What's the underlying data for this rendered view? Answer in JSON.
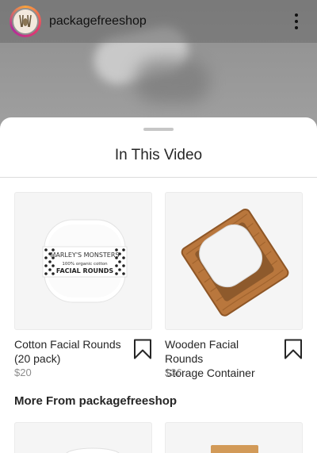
{
  "header": {
    "username": "packagefreeshop",
    "avatar_icon": "packagefreeshop-logo-icon",
    "more_icon": "more-options-icon"
  },
  "sheet": {
    "title": "In This Video",
    "products": [
      {
        "name_line1": "Cotton Facial Rounds",
        "name_line2": "(20 pack)",
        "price": "$20",
        "bookmark_icon": "bookmark-icon",
        "package_label": {
          "brand": "MARLEY'S MONSTERS",
          "subline": "100% organic cotton",
          "product": "FACIAL ROUNDS"
        }
      },
      {
        "name_line1": "Wooden Facial Rounds",
        "name_line2": "Storage Container",
        "price": "$36",
        "bookmark_icon": "bookmark-icon"
      }
    ],
    "more_section_title": "More From packagefreeshop"
  },
  "colors": {
    "text_primary": "#262626",
    "text_secondary": "#8e8e8e",
    "card_background": "#f5f5f5",
    "divider": "#dbdbdb"
  }
}
